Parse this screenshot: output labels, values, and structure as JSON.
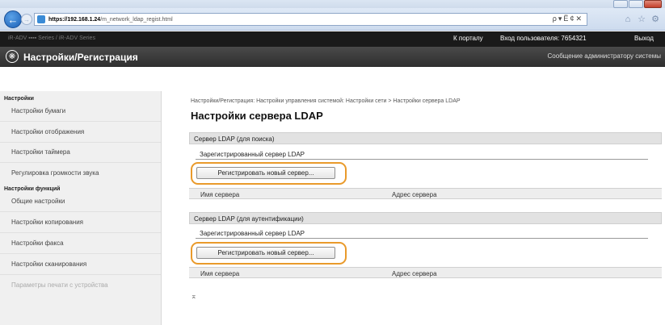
{
  "browser": {
    "url_host": "https://192.168.1.24",
    "url_path": "/m_network_ldap_regist.html",
    "addr_tools": "ρ▾Ё¢✕",
    "icons": [
      "home-icon",
      "star-icon",
      "gear-icon"
    ]
  },
  "header": {
    "device_name": "iR-ADV ▪▪▪▪ Series / iR-ADV Series",
    "portal_link": "К порталу",
    "login_label": "Вход пользователя: 7654321",
    "logout_link": "Выход"
  },
  "app_bar": {
    "title": "Настройки/Регистрация",
    "admin_message": "Сообщение администратору системы"
  },
  "sidebar": {
    "group1_title": "Настройки",
    "group1_items": [
      "Настройки бумаги",
      "Настройки отображения",
      "Настройки таймера",
      "Регулировка громкости звука"
    ],
    "group2_title": "Настройки функций",
    "group2_items": [
      "Общие настройки",
      "Настройки копирования",
      "Настройки факса",
      "Настройки сканирования",
      "Параметры печати с устройства"
    ]
  },
  "main": {
    "breadcrumb": "Настройки/Регистрация: Настройки управления системой: Настройки сети > Настройки сервера LDAP",
    "page_title": "Настройки сервера LDAP",
    "sections": [
      {
        "title": "Сервер LDAP (для поиска)",
        "registered_label": "Зарегистрированный сервер LDAP",
        "register_button": "Регистрировать новый сервер...",
        "col_server_name": "Имя сервера",
        "col_server_address": "Адрес сервера"
      },
      {
        "title": "Сервер LDAP (для аутентификации)",
        "registered_label": "Зарегистрированный сервер LDAP",
        "register_button": "Регистрировать новый сервер...",
        "col_server_name": "Имя сервера",
        "col_server_address": "Адрес сервера"
      }
    ],
    "top_link": "⌅"
  },
  "colors": {
    "highlight": "#e99a2b",
    "app_bar": "#333333",
    "header": "#1a1a1a"
  }
}
